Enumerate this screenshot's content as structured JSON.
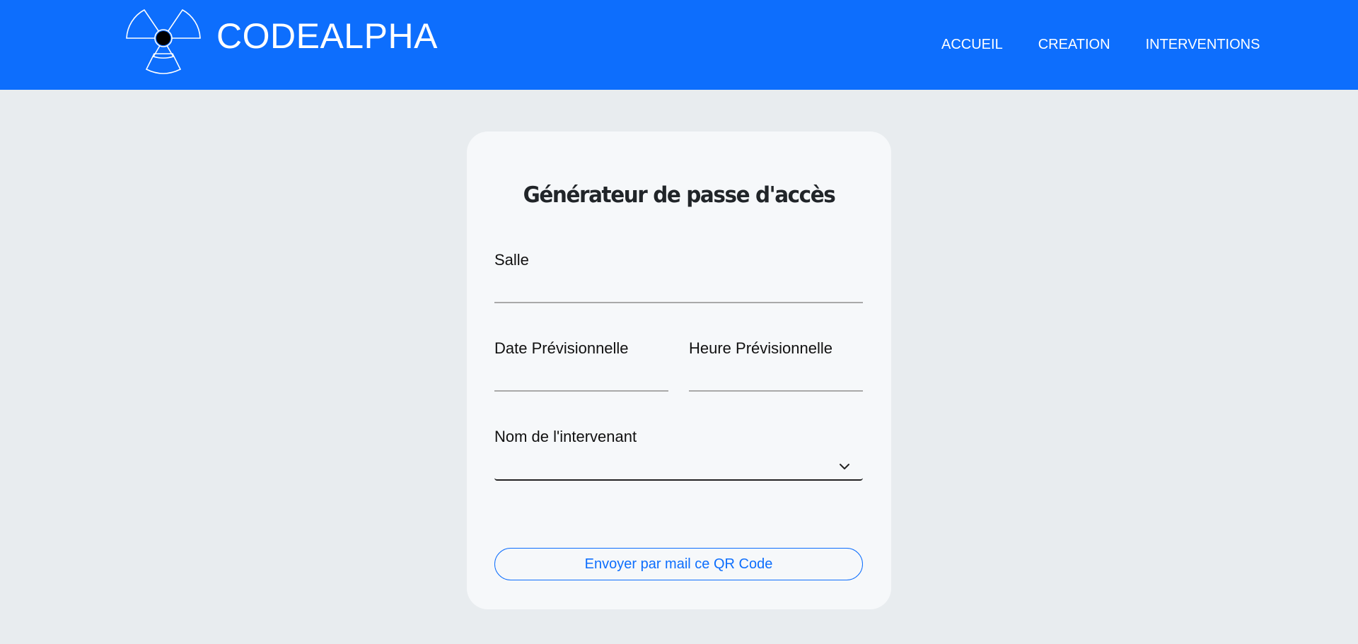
{
  "header": {
    "brand_name": "CODEALPHA",
    "logo_icon": "radiation-trefoil-icon",
    "nav": [
      {
        "label": "ACCUEIL"
      },
      {
        "label": "CREATION"
      },
      {
        "label": "INTERVENTIONS"
      }
    ],
    "background_color": "#0d6efd"
  },
  "form": {
    "title": "Générateur de passe d'accès",
    "salle": {
      "label": "Salle",
      "value": ""
    },
    "date": {
      "label": "Date Prévisionnelle",
      "value": ""
    },
    "heure": {
      "label": "Heure Prévisionnelle",
      "value": ""
    },
    "intervenant": {
      "label": "Nom de l'intervenant",
      "selected": ""
    },
    "submit_label": "Envoyer par mail ce QR Code"
  },
  "colors": {
    "accent": "#0d6efd",
    "page_background": "#e8ecef",
    "card_background": "#f6f8fa"
  }
}
